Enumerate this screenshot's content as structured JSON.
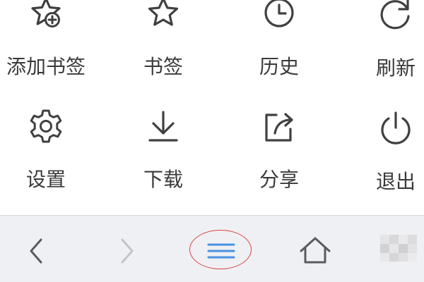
{
  "menu": {
    "items": [
      {
        "label": "添加书签",
        "icon": "add-bookmark-star-icon"
      },
      {
        "label": "书签",
        "icon": "star-icon"
      },
      {
        "label": "历史",
        "icon": "clock-icon"
      },
      {
        "label": "刷新",
        "icon": "refresh-icon"
      },
      {
        "label": "设置",
        "icon": "gear-icon"
      },
      {
        "label": "下载",
        "icon": "download-icon"
      },
      {
        "label": "分享",
        "icon": "share-icon"
      },
      {
        "label": "退出",
        "icon": "power-icon"
      }
    ]
  },
  "toolbar": {
    "buttons": [
      {
        "name": "back",
        "icon": "chevron-left-icon"
      },
      {
        "name": "forward",
        "icon": "chevron-right-icon"
      },
      {
        "name": "menu",
        "icon": "hamburger-menu-icon",
        "accent": "#4a90e2"
      },
      {
        "name": "home",
        "icon": "home-icon"
      }
    ]
  },
  "colors": {
    "icon": "#404040",
    "label": "#3a3a3a",
    "menu_accent": "#4a90e2",
    "highlight": "#d64545",
    "toolbar_bg": "#eff0f3"
  }
}
